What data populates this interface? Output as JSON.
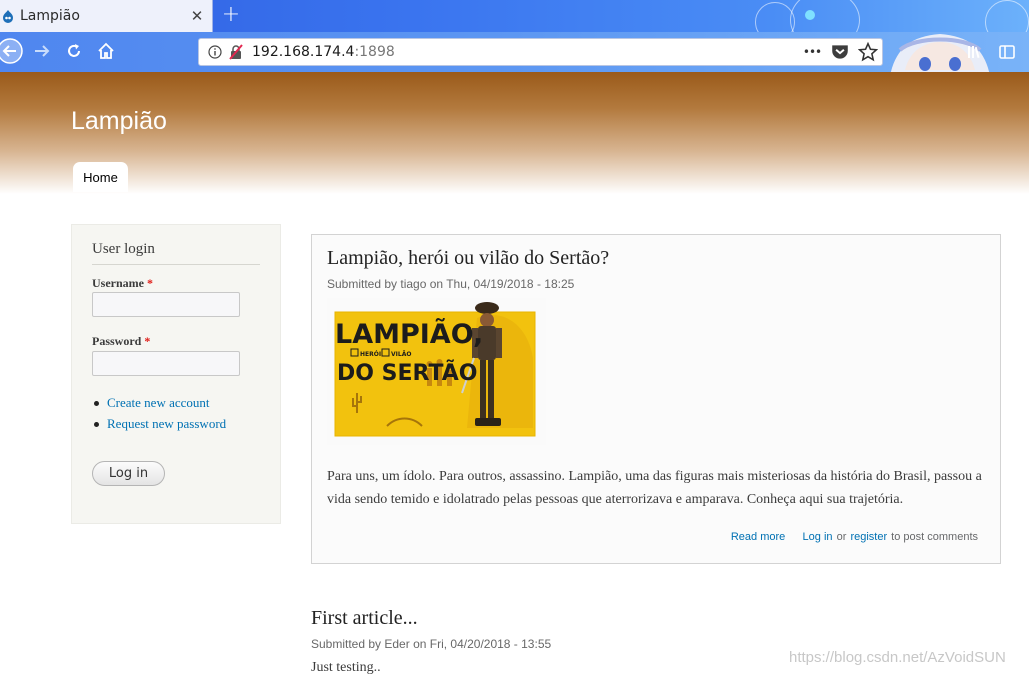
{
  "browser": {
    "tab_title": "Lampião",
    "new_tab_symbol": "+",
    "url_host": "192.168.174.4",
    "url_port": ":1898",
    "more_symbol": "•••"
  },
  "site": {
    "name": "Lampião",
    "nav": {
      "home": "Home"
    }
  },
  "sidebar": {
    "title": "User login",
    "username_label": "Username",
    "password_label": "Password",
    "required_mark": "*",
    "username_value": "",
    "password_value": "",
    "links": [
      "Create new account",
      "Request new password"
    ],
    "login_button": "Log in"
  },
  "articles": [
    {
      "title": "Lampião, herói ou vilão do Sertão?",
      "submitted_prefix": "Submitted by ",
      "author": "tiago",
      "submitted_on": " on Thu, 04/19/2018 - 18:25",
      "image_text_line1": "LAMPIÃO,",
      "image_text_line2": "DO SERTÃO",
      "image_check1": "HERÓI",
      "image_check2": "VILÃO",
      "body": "Para uns, um ídolo. Para outros, assassino. Lampião, uma das figuras mais misteriosas da história do Brasil, passou a vida sendo temido e idolatrado pelas pessoas que aterrorizava e amparava. Conheça aqui sua trajetória.",
      "read_more": "Read more",
      "log_in": "Log in",
      "or": " or ",
      "register": "register",
      "to_post": " to post comments"
    },
    {
      "title": "First article...",
      "submitted_prefix": "Submitted by ",
      "author": "Eder",
      "submitted_on": " on Fri, 04/20/2018 - 13:55",
      "body": "Just testing.."
    }
  ],
  "watermark": "https://blog.csdn.net/AzVoidSUN",
  "colors": {
    "link": "#0071b3",
    "header_brown": "#9a5a1a",
    "tab_blue": "#3a74ef"
  }
}
